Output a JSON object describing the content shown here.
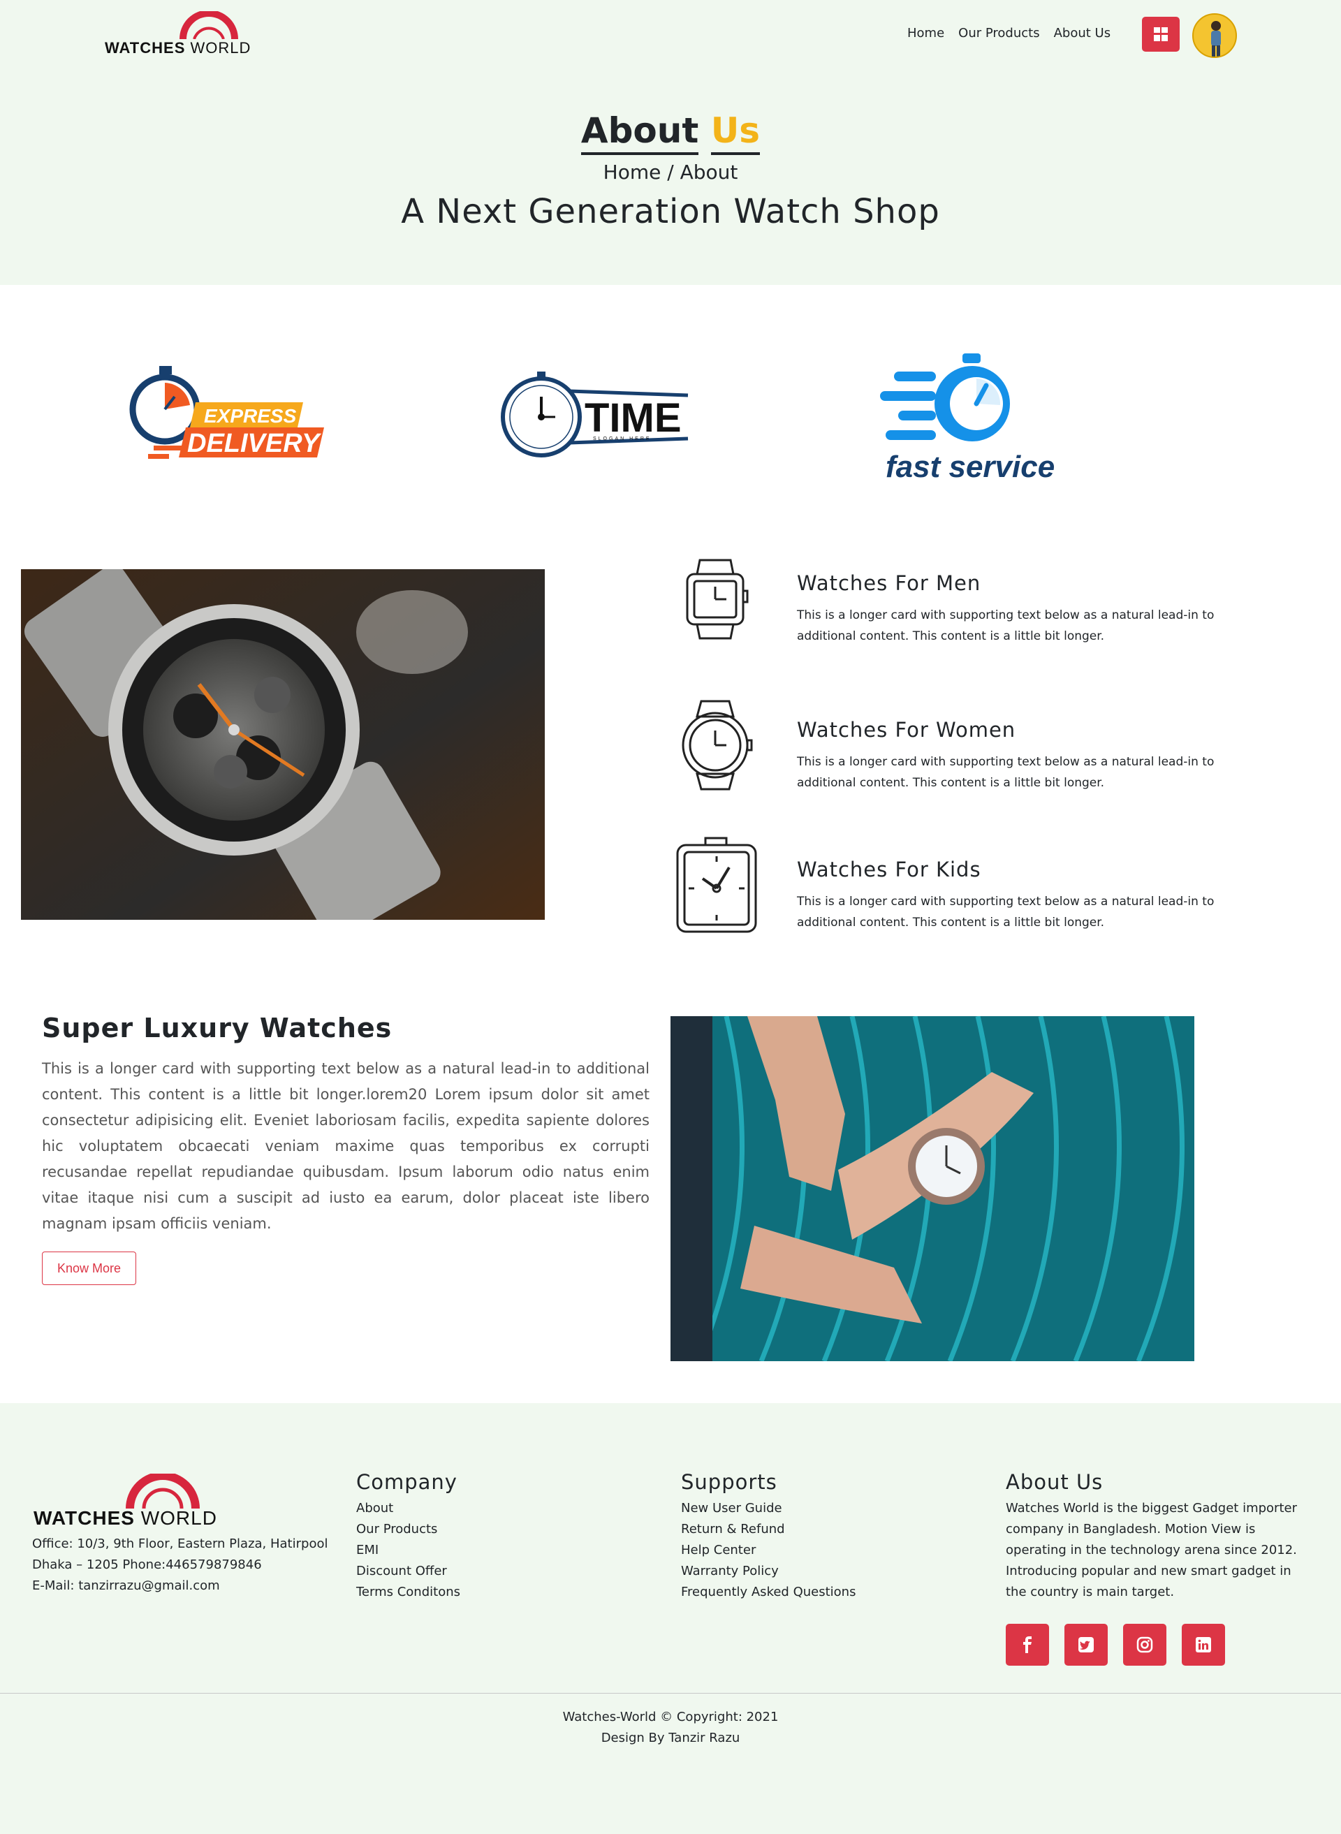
{
  "nav": {
    "logo": {
      "word1": "WATCHES",
      "word2": "WORLD"
    },
    "links": [
      "Home",
      "Our Products",
      "About Us"
    ],
    "grid_icon": "grid-icon",
    "avatar_icon": "user-avatar"
  },
  "hero": {
    "title_part1": "About",
    "title_part2": "Us",
    "breadcrumb": "Home / About",
    "subtitle": "A Next Generation Watch Shop"
  },
  "brand_logos": {
    "express": {
      "line1": "EXPRESS",
      "line2": "DELIVERY"
    },
    "time": {
      "word": "TIME",
      "slogan": "SLOGAN HERE"
    },
    "fast": {
      "word": "fast service"
    }
  },
  "features": [
    {
      "title": "Watches For Men",
      "text": "This is a longer card with supporting text below as a natural lead-in to additional content. This content is a little bit longer."
    },
    {
      "title": "Watches For Women",
      "text": "This is a longer card with supporting text below as a natural lead-in to additional content. This content is a little bit longer."
    },
    {
      "title": "Watches For Kids",
      "text": "This is a longer card with supporting text below as a natural lead-in to additional content. This content is a little bit longer."
    }
  ],
  "luxury": {
    "title": "Super Luxury Watches",
    "text": "This is a longer card with supporting text below as a natural lead-in to additional content. This content is a little bit longer.lorem20 Lorem ipsum dolor sit amet consectetur adipisicing elit. Eveniet laboriosam facilis, expedita sapiente dolores hic voluptatem obcaecati veniam maxime quas temporibus ex corrupti recusandae repellat repudiandae quibusdam. Ipsum laborum odio natus enim vitae itaque nisi cum a suscipit ad iusto ea earum, dolor placeat iste libero magnam ipsam officiis veniam.",
    "button": "Know More"
  },
  "footer": {
    "address": "Office: 10/3, 9th Floor, Eastern Plaza, Hatirpool Dhaka – 1205 Phone:446579879846",
    "email": "E-Mail: tanzirrazu@gmail.com",
    "company": {
      "title": "Company",
      "items": [
        "About",
        "Our Products",
        "EMI",
        "Discount Offer",
        "Terms Conditons"
      ]
    },
    "supports": {
      "title": "Supports",
      "items": [
        "New User Guide",
        "Return & Refund",
        "Help Center",
        "Warranty Policy",
        "Frequently Asked Questions"
      ]
    },
    "about": {
      "title": "About Us",
      "text": "Watches World is the biggest Gadget importer company in Bangladesh. Motion View is operating in the technology arena since 2012. Introducing popular and new smart gadget in the country is main target."
    },
    "socials": [
      "facebook-icon",
      "twitter-icon",
      "instagram-icon",
      "linkedin-icon"
    ],
    "copyright": "Watches-World © Copyright: 2021",
    "design": "Design By Tanzir Razu"
  },
  "colors": {
    "accent": "#dc3545",
    "gold": "#f3b319",
    "mint": "#f0f8ef",
    "blue": "#1591e8",
    "navy": "#173f6e"
  }
}
